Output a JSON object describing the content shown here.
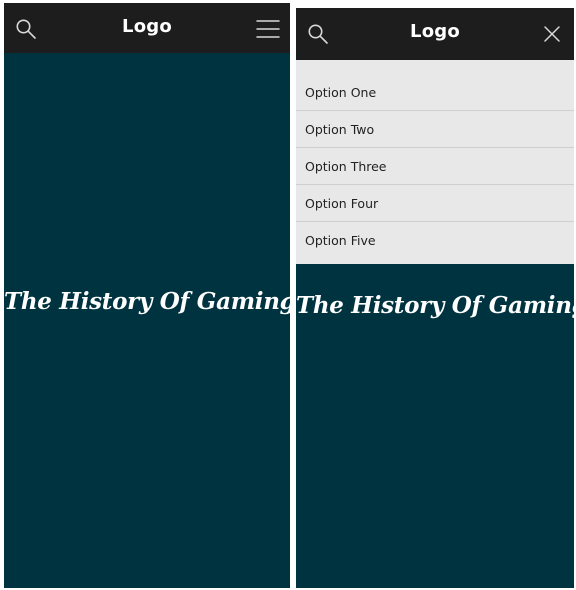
{
  "colors": {
    "bar_bg": "#1d1d1d",
    "hero_bg": "#003340",
    "menu_bg": "#e8e8e8"
  },
  "left_screen": {
    "logo": "Logo",
    "hero_title": "The History Of Gaming",
    "icons": {
      "left": "search-icon",
      "right": "hamburger-menu-icon"
    }
  },
  "right_screen": {
    "logo": "Logo",
    "hero_title": "The History Of Gaming",
    "icons": {
      "left": "search-icon",
      "right": "close-icon"
    },
    "menu": {
      "items": [
        {
          "label": "Option One"
        },
        {
          "label": "Option Two"
        },
        {
          "label": "Option Three"
        },
        {
          "label": "Option Four"
        },
        {
          "label": "Option Five"
        }
      ]
    }
  }
}
